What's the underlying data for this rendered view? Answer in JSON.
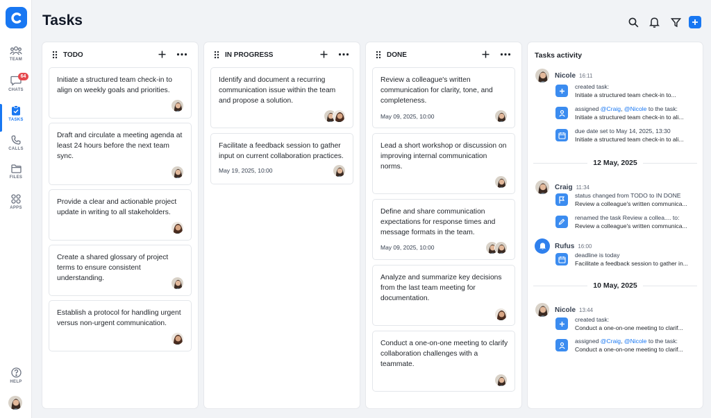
{
  "app": {
    "logo_letter": "C",
    "page_title": "Tasks"
  },
  "sidebar": {
    "items": [
      {
        "id": "team",
        "label": "TEAM",
        "icon": "team-icon"
      },
      {
        "id": "chats",
        "label": "CHATS",
        "icon": "chat-icon",
        "badge": "64"
      },
      {
        "id": "tasks",
        "label": "TASKS",
        "icon": "tasks-icon",
        "active": true
      },
      {
        "id": "calls",
        "label": "CALLS",
        "icon": "phone-icon"
      },
      {
        "id": "files",
        "label": "FILES",
        "icon": "folder-icon"
      },
      {
        "id": "apps",
        "label": "APPS",
        "icon": "apps-icon"
      }
    ],
    "help_label": "HELP"
  },
  "columns": [
    {
      "title": "TODO",
      "cards": [
        {
          "text": "Initiate a structured team check-in to align on weekly goals and priorities.",
          "date": ""
        },
        {
          "text": "Draft and circulate a meeting agenda at least 24 hours before the next team sync.",
          "date": ""
        },
        {
          "text": "Provide a clear and actionable project update in writing to all stakeholders.",
          "date": ""
        },
        {
          "text": "Create a shared glossary of project terms to ensure consistent understanding.",
          "date": ""
        },
        {
          "text": "Establish a protocol for handling urgent versus non-urgent communication.",
          "date": ""
        }
      ]
    },
    {
      "title": "IN PROGRESS",
      "cards": [
        {
          "text": "Identify and document a recurring communication issue within the team and propose a solution.",
          "date": ""
        },
        {
          "text": "Facilitate a feedback session to gather input on current collaboration practices.",
          "date": "May 19, 2025, 10:00"
        }
      ]
    },
    {
      "title": "DONE",
      "cards": [
        {
          "text": "Review a colleague's written communication for clarity, tone, and completeness.",
          "date": "May 09, 2025, 10:00"
        },
        {
          "text": "Lead a short workshop or discussion on improving internal communication norms.",
          "date": ""
        },
        {
          "text": "Define and share communication expectations for response times and message formats in the team.",
          "date": "May 09, 2025, 10:00"
        },
        {
          "text": "Analyze and summarize key decisions from the last team meeting for documentation.",
          "date": ""
        },
        {
          "text": "Conduct a one-on-one meeting to clarify collaboration challenges with a teammate.",
          "date": ""
        }
      ]
    }
  ],
  "activity": {
    "title": "Tasks activity",
    "groups": [
      {
        "user": "Nicole",
        "time": "16:11",
        "entries": [
          {
            "icon": "plus-icon",
            "line1": "created task:",
            "line2": "Initiate a structured team check-in to..."
          },
          {
            "icon": "user-assign-icon",
            "line1_pre": "assigned ",
            "mention1": "@Craig",
            "sep": ", ",
            "mention2": "@Nicole",
            "line1_post": " to the task:",
            "line2": "Initiate a structured team check-in to ali..."
          },
          {
            "icon": "calendar-icon",
            "line1": "due date set to May 14, 2025, 13:30",
            "line2": "Initiate a structured team check-in to ali..."
          }
        ]
      },
      {
        "date_divider": "12 May, 2025"
      },
      {
        "user": "Craig",
        "time": "11:34",
        "entries": [
          {
            "icon": "flag-icon",
            "line1": "status changed from TODO to IN DONE",
            "line2": "Review a colleague's written communica..."
          },
          {
            "icon": "pencil-icon",
            "line1": "renamed the task Review a collea.... to:",
            "line2": "Review a colleague's written communica..."
          }
        ]
      },
      {
        "user": "Rufus",
        "time": "16:00",
        "entries": [
          {
            "icon": "calendar-icon",
            "line1": "deadline is today",
            "line2": "Facilitate a feedback session to gather in..."
          }
        ]
      },
      {
        "date_divider": "10 May, 2025"
      },
      {
        "user": "Nicole",
        "time": "13:44",
        "entries": [
          {
            "icon": "plus-icon",
            "line1": "created task:",
            "line2": "Conduct a one-on-one meeting to clarif..."
          },
          {
            "icon": "user-assign-icon",
            "line1_pre": "assigned ",
            "mention1": "@Craig",
            "sep": ", ",
            "mention2": "@Nicole",
            "line1_post": " to the task:",
            "line2": "Conduct a one-on-one meeting to clarif..."
          }
        ]
      }
    ]
  },
  "colors": {
    "accent": "#1877f2",
    "badge": "#e5484d",
    "activity_icon": "#3b8cf0"
  }
}
